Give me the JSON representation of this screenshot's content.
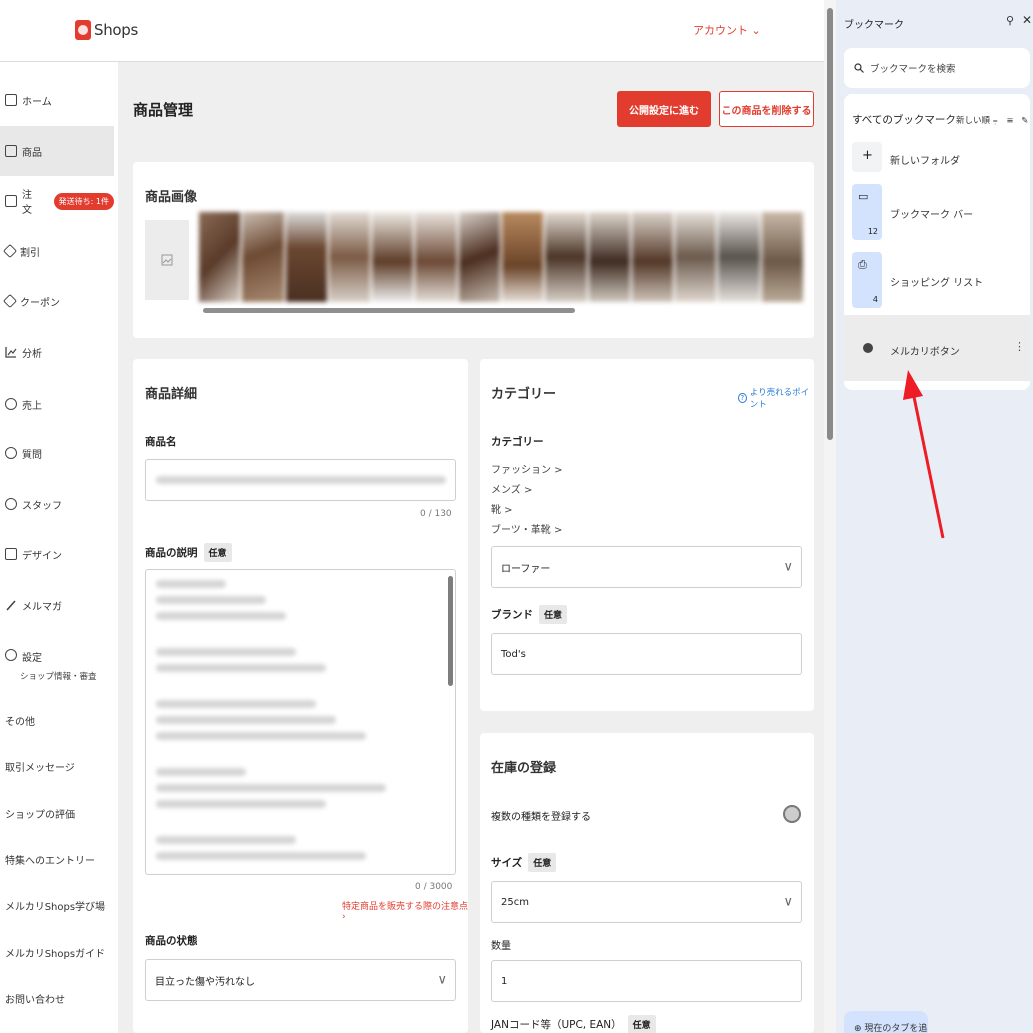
{
  "header": {
    "logo_text": "Shops",
    "account": "アカウント ⌄"
  },
  "nav": {
    "items": [
      {
        "label": "ホーム",
        "icon": "home-icon"
      },
      {
        "label": "商品",
        "icon": "product-icon"
      },
      {
        "label": "注文",
        "icon": "order-icon",
        "badge": "発送待ち: 1件"
      },
      {
        "label": "割引",
        "icon": "tag-icon"
      },
      {
        "label": "クーポン",
        "icon": "coupon-icon"
      },
      {
        "label": "分析",
        "icon": "chart-icon"
      },
      {
        "label": "売上",
        "icon": "yen-icon"
      },
      {
        "label": "質問",
        "icon": "question-icon"
      },
      {
        "label": "スタッフ",
        "icon": "staff-icon"
      },
      {
        "label": "デザイン",
        "icon": "design-icon"
      },
      {
        "label": "メルマガ",
        "icon": "pen-icon"
      },
      {
        "label": "設定",
        "icon": "gear-icon",
        "sub": "ショップ情報・審査"
      }
    ],
    "text_links": [
      "その他",
      "取引メッセージ",
      "ショップの評価",
      "特集へのエントリー",
      "メルカリShops学び場",
      "メルカリShopsガイド",
      "お問い合わせ"
    ]
  },
  "main": {
    "title": "商品管理",
    "publish_button": "公開設定に進む",
    "delete_button": "この商品を削除する",
    "images_card": {
      "title": "商品画像"
    },
    "details_card": {
      "title": "商品詳細",
      "name_label": "商品名",
      "name_counter": "0 / 130",
      "desc_label": "商品の説明",
      "desc_tag": "任意",
      "desc_counter": "0 / 3000",
      "desc_notice": "特定商品を販売する際の注意点 ›",
      "condition_label": "商品の状態",
      "condition_value": "目立った傷や汚れなし"
    },
    "category_card": {
      "title": "カテゴリー",
      "tip_link": "より売れるポイント",
      "category_label": "カテゴリー",
      "path": [
        "ファッション >",
        "メンズ >",
        "靴 >",
        "ブーツ・革靴 >"
      ],
      "category_value": "ローファー",
      "brand_label": "ブランド",
      "brand_tag": "任意",
      "brand_value": "Tod's"
    },
    "stock_card": {
      "title": "在庫の登録",
      "multi_label": "複数の種類を登録する",
      "size_label": "サイズ",
      "size_tag": "任意",
      "size_value": "25cm",
      "qty_label": "数量",
      "qty_value": "1",
      "jan_label": "JANコード等（UPC, EAN）",
      "jan_tag": "任意"
    }
  },
  "bookmarks": {
    "title": "ブックマーク",
    "search_placeholder": "ブックマークを検索",
    "all_label": "すべてのブックマーク",
    "sort_label": "新しい順",
    "items": [
      {
        "label": "新しいフォルダ",
        "icon": "plus-icon"
      },
      {
        "label": "ブックマーク バー",
        "icon": "folder-icon",
        "count": "12"
      },
      {
        "label": "ショッピング リスト",
        "icon": "shopping-bag-icon",
        "count": "4"
      },
      {
        "label": "メルカリボタン",
        "icon": "globe-icon"
      }
    ],
    "add_tab": "現在のタブを追加"
  },
  "colors": {
    "accent": "#e23c2f",
    "panel_bg": "#e9eef6",
    "folder_bg": "#d3e3fd",
    "annotation_arrow": "#ee1c25"
  }
}
